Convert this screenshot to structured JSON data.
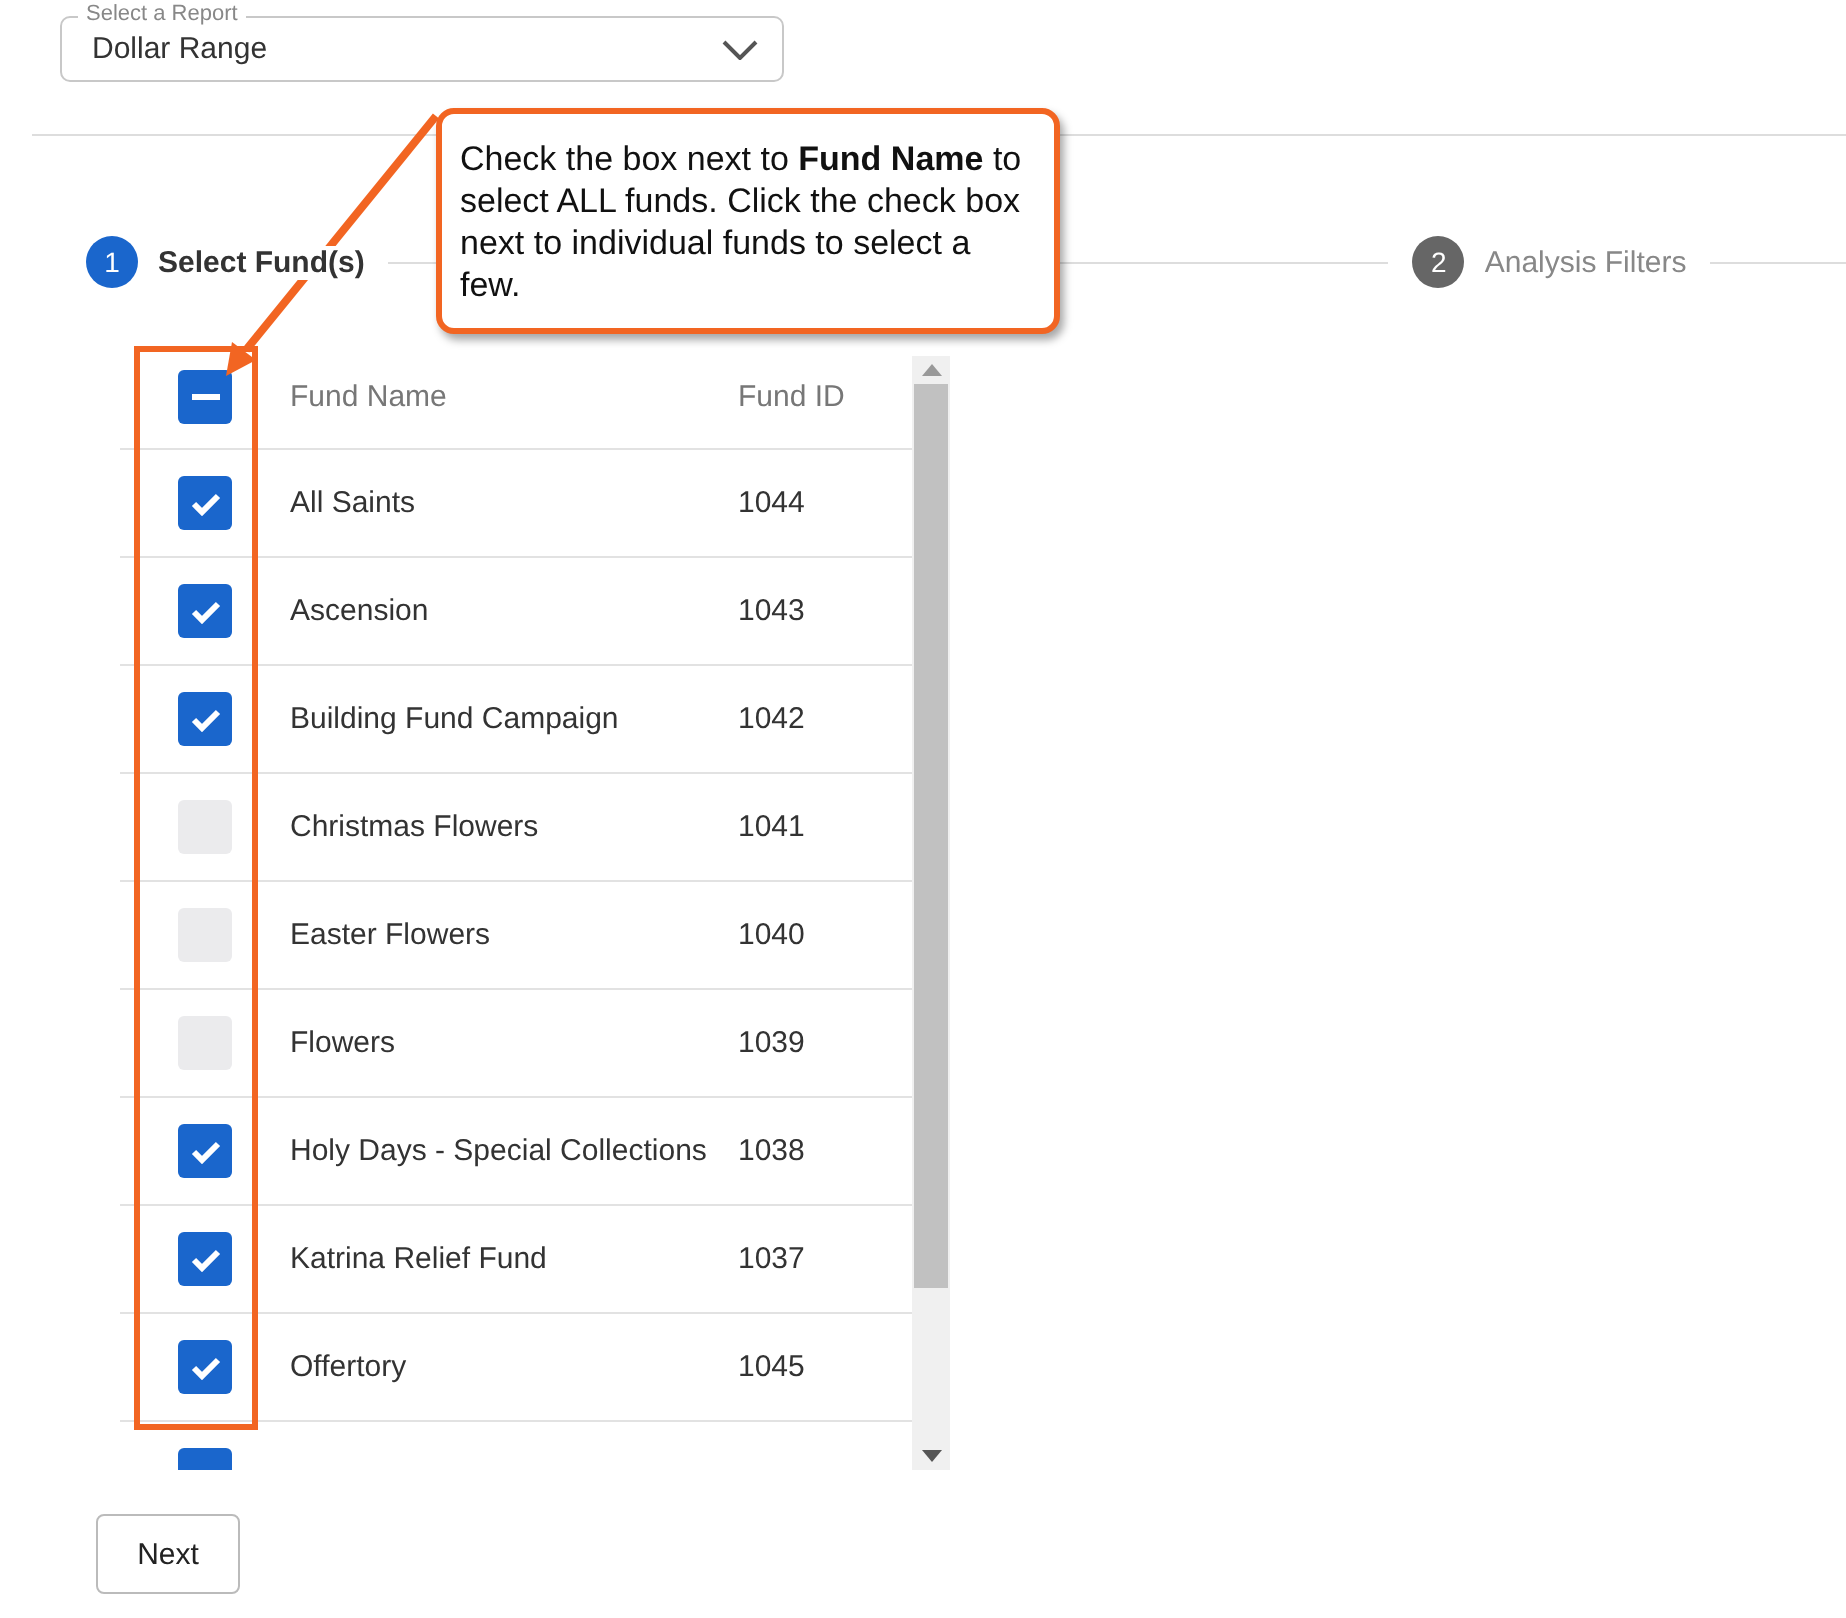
{
  "report_select": {
    "label": "Select a Report",
    "value": "Dollar Range"
  },
  "steps": [
    {
      "number": "1",
      "label": "Select Fund(s)",
      "selected": true
    },
    {
      "number": "2",
      "label": "Analysis Filters",
      "selected": false
    }
  ],
  "callout": {
    "text": "Check the box next to **Fund Name** to select ALL funds. Click the check box next to individual funds to select a few."
  },
  "table": {
    "header_checkbox": {
      "indeterminate": true
    },
    "columns": [
      "Fund Name",
      "Fund ID"
    ],
    "rows": [
      {
        "name": "All Saints",
        "id": "1044",
        "checked": true
      },
      {
        "name": "Ascension",
        "id": "1043",
        "checked": true
      },
      {
        "name": "Building Fund Campaign",
        "id": "1042",
        "checked": true
      },
      {
        "name": "Christmas Flowers",
        "id": "1041",
        "checked": false
      },
      {
        "name": "Easter Flowers",
        "id": "1040",
        "checked": false
      },
      {
        "name": "Flowers",
        "id": "1039",
        "checked": false
      },
      {
        "name": "Holy Days - Special Collections",
        "id": "1038",
        "checked": true
      },
      {
        "name": "Katrina Relief Fund",
        "id": "1037",
        "checked": true
      },
      {
        "name": "Offertory",
        "id": "1045",
        "checked": true
      },
      {
        "checked": true
      }
    ]
  },
  "buttons": [
    {
      "label": "Next"
    }
  ]
}
